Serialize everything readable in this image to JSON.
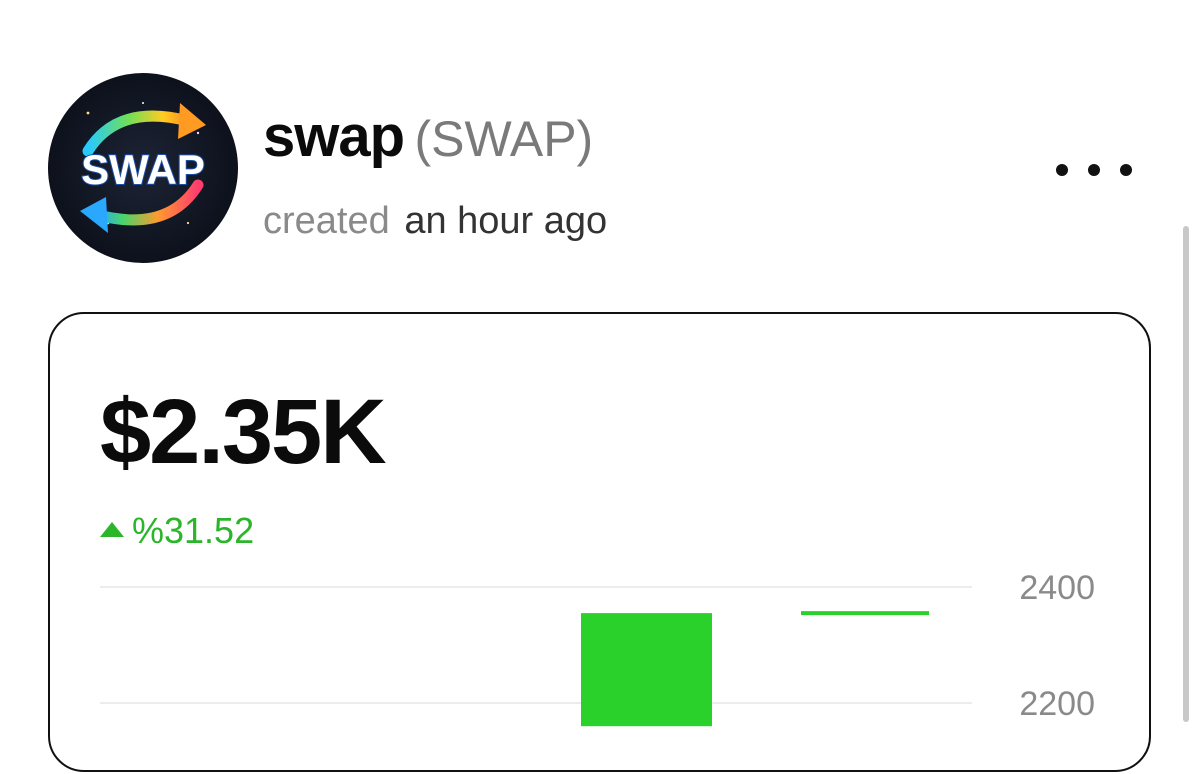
{
  "token": {
    "name": "swap",
    "ticker": "(SWAP)",
    "avatar_text": "SWAP",
    "created_label": "created",
    "created_time": "an hour ago"
  },
  "menu": {
    "icon": "more-horizontal-icon"
  },
  "card": {
    "price": "$2.35K",
    "change": "%31.52",
    "change_direction": "up",
    "colors": {
      "positive": "#2bb52b",
      "bar": "#2bd12b"
    }
  },
  "chart_data": {
    "type": "bar",
    "ytick_labels": [
      "2400",
      "2200"
    ],
    "yticks": [
      2400,
      2200
    ],
    "bars": [
      {
        "x_index": 0,
        "open": 2160,
        "close": 2355
      }
    ],
    "last_price_line": 2355,
    "ylim": [
      2140,
      2420
    ]
  }
}
